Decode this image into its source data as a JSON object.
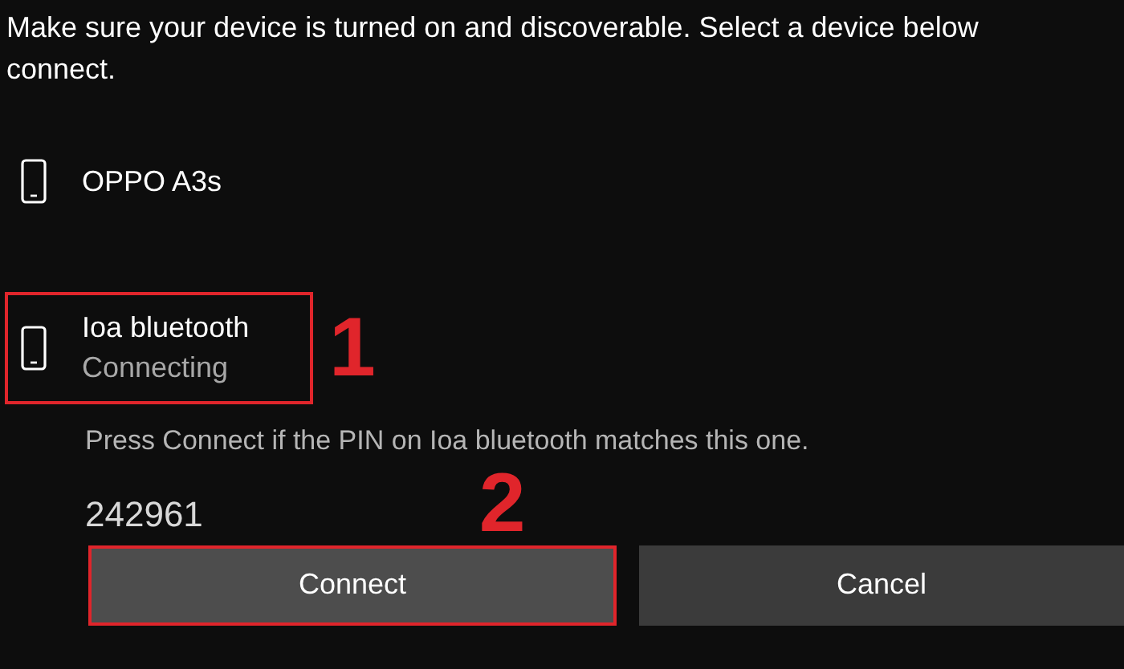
{
  "instructions": [
    "Make sure your device is turned on and discoverable. Select a device below",
    "connect."
  ],
  "devices": [
    {
      "name": "OPPO A3s",
      "selected": false
    },
    {
      "name": "Ioa bluetooth",
      "status": "Connecting",
      "selected": true,
      "annotation": "1"
    }
  ],
  "pin_prompt": "Press Connect if the PIN on Ioa bluetooth matches this one.",
  "pin": "242961",
  "buttons": [
    {
      "label": "Connect",
      "kind": "primary",
      "highlighted": true,
      "annotation": "2"
    },
    {
      "label": "Cancel",
      "kind": "secondary",
      "highlighted": false
    }
  ]
}
